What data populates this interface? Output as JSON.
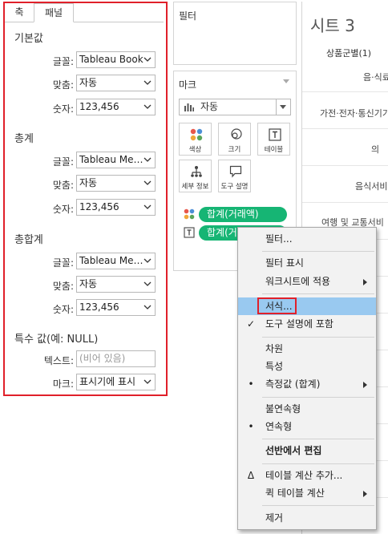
{
  "format_pane": {
    "tabs": [
      {
        "label": "축"
      },
      {
        "label": "패널"
      }
    ],
    "sections": [
      {
        "title": "기본값",
        "rows": [
          {
            "label": "글꼴:",
            "value": "Tableau Book"
          },
          {
            "label": "맞춤:",
            "value": "자동"
          },
          {
            "label": "숫자:",
            "value": "123,456"
          }
        ]
      },
      {
        "title": "총계",
        "rows": [
          {
            "label": "글꼴:",
            "value": "Tableau Medium"
          },
          {
            "label": "맞춤:",
            "value": "자동"
          },
          {
            "label": "숫자:",
            "value": "123,456"
          }
        ]
      },
      {
        "title": "총합계",
        "rows": [
          {
            "label": "글꼴:",
            "value": "Tableau Medium"
          },
          {
            "label": "맞춤:",
            "value": "자동"
          },
          {
            "label": "숫자:",
            "value": "123,456"
          }
        ]
      },
      {
        "title": "특수 값(예: NULL)",
        "rows": [
          {
            "label": "텍스트:",
            "placeholder": "(비어 있음)"
          },
          {
            "label": "마크:",
            "value": "표시기에 표시"
          }
        ]
      }
    ]
  },
  "filters": {
    "title": "필터"
  },
  "marks": {
    "title": "마크",
    "mark_type": "자동",
    "buttons": [
      {
        "label": "색상",
        "icon": "color-icon"
      },
      {
        "label": "크기",
        "icon": "size-icon"
      },
      {
        "label": "테이블",
        "icon": "label-icon"
      },
      {
        "label": "세부 정보",
        "icon": "detail-icon"
      },
      {
        "label": "도구 설명",
        "icon": "tooltip-icon"
      }
    ],
    "pills": [
      {
        "label": "합계(거래액)",
        "icon": "color-icon"
      },
      {
        "label": "합계(거래액)",
        "icon": "label-icon"
      }
    ]
  },
  "sheet": {
    "title": "시트 3",
    "header": "상품군별(1)",
    "categories": [
      "음·식료",
      "가전·전자·통신기기",
      "의",
      "음식서비",
      "여행 및 교통서비"
    ]
  },
  "context_menu": {
    "items": [
      {
        "label": "필터..."
      },
      {
        "label": "필터 표시"
      },
      {
        "label": "워크시트에 적용"
      },
      {
        "label": "서식..."
      },
      {
        "label": "도구 설명에 포함",
        "mark": "✓"
      },
      {
        "label": "차원"
      },
      {
        "label": "특성"
      },
      {
        "label": "측정값 (합계)",
        "mark": "•"
      },
      {
        "label": "불연속형"
      },
      {
        "label": "연속형",
        "mark": "•"
      },
      {
        "label": "선반에서 편집"
      },
      {
        "label": "테이블 계산 추가...",
        "mark": "Δ"
      },
      {
        "label": "퀵 테이블 계산"
      },
      {
        "label": "제거"
      }
    ]
  },
  "colors": {
    "pill": "#16b574",
    "highlight": "#99c9f0",
    "annotation_red": "#e0202a"
  }
}
